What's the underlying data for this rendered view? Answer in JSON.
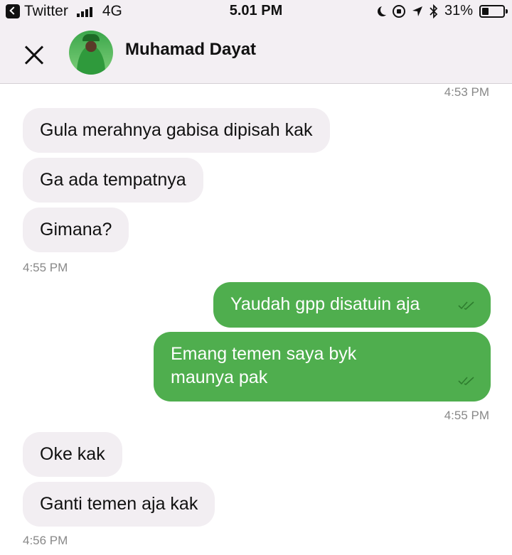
{
  "status_bar": {
    "back_app": "Twitter",
    "network": "4G",
    "time": "5.01 PM",
    "battery": "31%",
    "battery_level": 0.31
  },
  "header": {
    "contact_name": "Muhamad Dayat"
  },
  "messages": [
    {
      "text": "4:53 PM"
    },
    {
      "text": "Gula merahnya gabisa dipisah kak"
    },
    {
      "text": "Ga ada tempatnya"
    },
    {
      "text": "Gimana?"
    },
    {
      "text": "4:55 PM"
    },
    {
      "text": "Yaudah gpp disatuin aja"
    },
    {
      "text_line1": "Emang temen saya byk",
      "text_line2": "maunya pak"
    },
    {
      "text": "4:55 PM"
    },
    {
      "text": "Oke kak"
    },
    {
      "text": "Ganti temen aja kak"
    },
    {
      "text": "4:56 PM"
    }
  ],
  "colors": {
    "outgoing_bubble": "#4fae4e",
    "incoming_bubble": "#f2eef2",
    "header_bg": "#f3eff3"
  }
}
